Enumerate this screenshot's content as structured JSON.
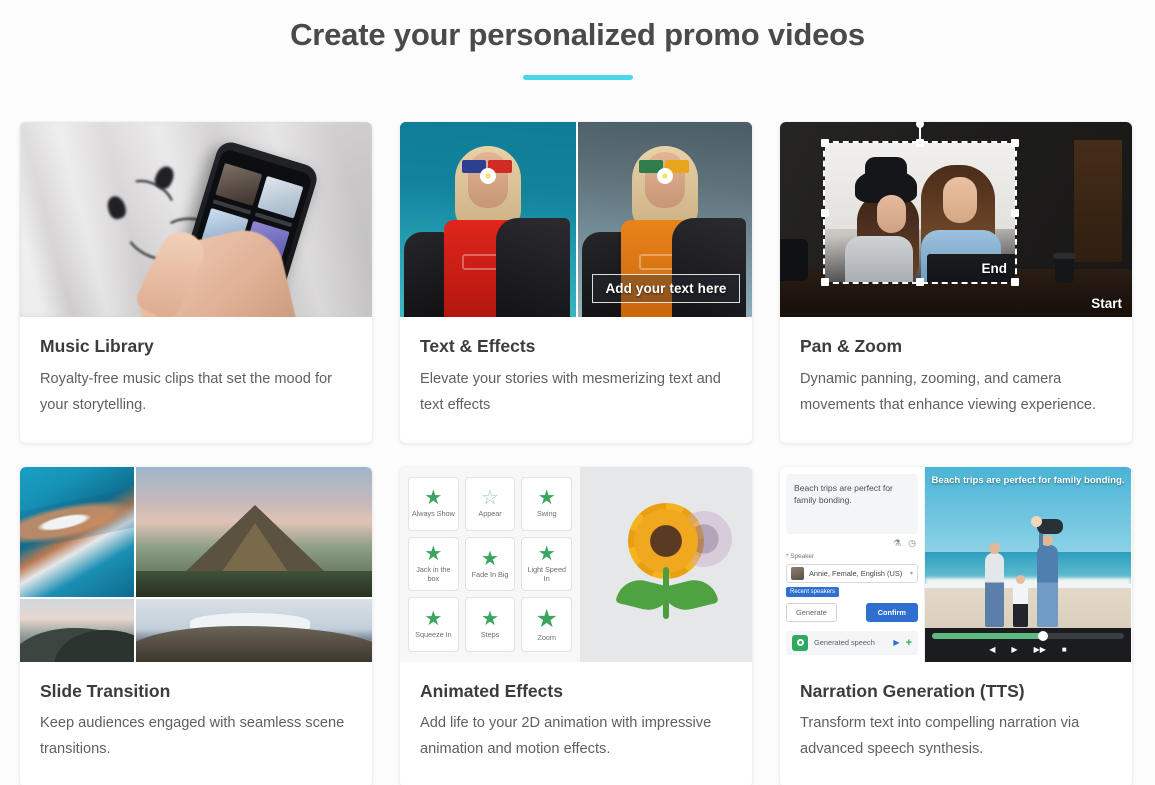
{
  "header": {
    "title": "Create your personalized promo videos",
    "accent_color": "#4ad7e8"
  },
  "cards": [
    {
      "id": "music-library",
      "heading": "Music Library",
      "description": "Royalty-free music clips that set the mood for your storytelling.",
      "media": {
        "type": "photo",
        "alt": "Hand holding a smartphone showing a music app with earbuds on a white sheet"
      }
    },
    {
      "id": "text-effects",
      "heading": "Text & Effects",
      "description": "Elevate your stories with mesmerizing text and text effects",
      "media": {
        "type": "split-photo",
        "alt": "Before and after photo of a woman in colorful sunglasses",
        "overlay_text": "Add your text here"
      }
    },
    {
      "id": "pan-zoom",
      "heading": "Pan & Zoom",
      "description": "Dynamic panning, zooming, and camera movements that enhance viewing experience.",
      "media": {
        "type": "crop-editor",
        "alt": "Two women looking at a laptop with a dashed crop selection overlay",
        "end_label": "End",
        "start_label": "Start"
      }
    },
    {
      "id": "slide-transition",
      "heading": "Slide Transition",
      "description": "Keep audiences engaged with seamless scene transitions.",
      "media": {
        "type": "photo-grid",
        "alt": "Four landscape photos: aerial coastline, Kirkjufell mountain, misty mountains, snow-capped volcano"
      }
    },
    {
      "id": "animated-effects",
      "heading": "Animated Effects",
      "description": "Add life to your 2D animation with impressive animation and motion effects.",
      "media": {
        "type": "effects-panel",
        "alt": "Animation effect picker beside an animated sunflower",
        "effects": [
          {
            "name": "Always Show",
            "style": "solid"
          },
          {
            "name": "Appear",
            "style": "outline"
          },
          {
            "name": "Swing",
            "style": "solid"
          },
          {
            "name": "Jack in the box",
            "style": "solid"
          },
          {
            "name": "Fade In Big",
            "style": "solid"
          },
          {
            "name": "Light Speed In",
            "style": "solid"
          },
          {
            "name": "Squeeze In",
            "style": "solid"
          },
          {
            "name": "Steps",
            "style": "solid"
          },
          {
            "name": "Zoom",
            "style": "big"
          }
        ]
      }
    },
    {
      "id": "narration-generation",
      "heading": "Narration Generation (TTS)",
      "description": "Transform text into compelling narration via advanced speech synthesis.",
      "media": {
        "type": "tts-panel",
        "script_text": "Beach trips are perfect for family bonding.",
        "speaker_label": "Speaker",
        "speaker_required_marker": "*",
        "speaker_value": "Annie, Female, English (US)",
        "recent_badge": "Recent speakers",
        "generate_label": "Generate",
        "confirm_label": "Confirm",
        "generated_label": "Generated speech",
        "caption_text": "Beach trips are perfect for family bonding.",
        "progress_percent": 58,
        "controls": [
          "◀",
          "▶",
          "▶▶",
          "■"
        ],
        "accent_green": "#2fa95f",
        "accent_blue": "#2f6fd0"
      }
    }
  ]
}
